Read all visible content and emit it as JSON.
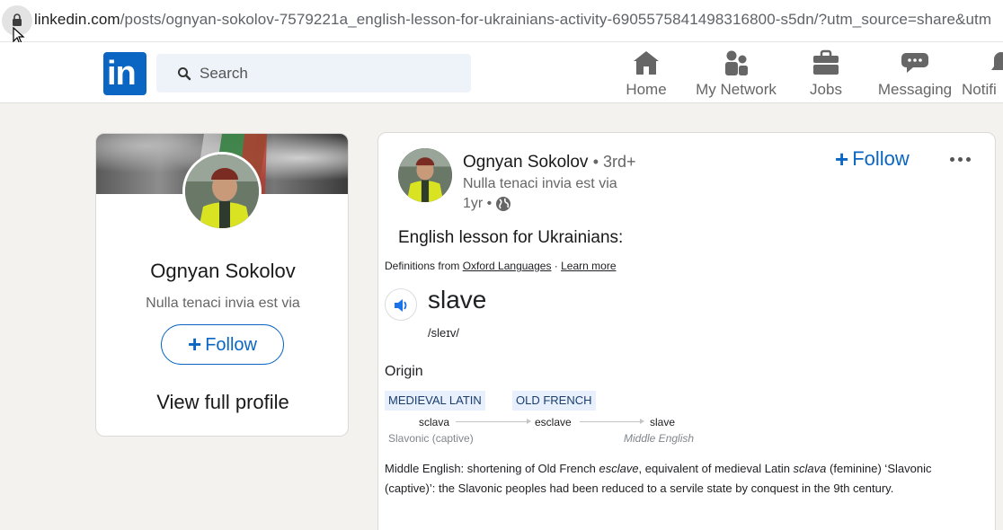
{
  "browser": {
    "url_domain": "linkedin.com",
    "url_path": "/posts/ognyan-sokolov-7579221a_english-lesson-for-ukrainians-activity-6905575841498316800-s5dn/?utm_source=share&utm"
  },
  "nav": {
    "logo_text": "in",
    "search_placeholder": "Search",
    "items": [
      {
        "label": "Home",
        "icon": "home-icon"
      },
      {
        "label": "My Network",
        "icon": "network-icon"
      },
      {
        "label": "Jobs",
        "icon": "briefcase-icon"
      },
      {
        "label": "Messaging",
        "icon": "messaging-icon"
      },
      {
        "label": "Notifi",
        "icon": "bell-icon"
      }
    ]
  },
  "profile_card": {
    "name": "Ognyan Sokolov",
    "headline": "Nulla tenaci invia est via",
    "follow_label": "Follow",
    "view_profile_label": "View full profile"
  },
  "post": {
    "author": "Ognyan Sokolov",
    "degree": "• 3rd+",
    "headline": "Nulla tenaci invia est via",
    "time": "1yr •",
    "follow_label": "Follow",
    "text": "English lesson for Ukrainians:"
  },
  "dictionary": {
    "defs_prefix": "Definitions from ",
    "source": "Oxford Languages",
    "separator": " · ",
    "learn_more": "Learn more",
    "word": "slave",
    "phonetic": "/sleɪv/",
    "origin_label": "Origin",
    "tags": [
      "MEDIEVAL LATIN",
      "OLD FRENCH"
    ],
    "etymology": [
      {
        "word": "sclava",
        "gloss": "Slavonic (captive)"
      },
      {
        "word": "esclave",
        "gloss": ""
      },
      {
        "word": "slave",
        "gloss": "Middle English"
      }
    ],
    "def_1": "Middle English: shortening of Old French ",
    "def_2": "esclave",
    "def_3": ", equivalent of medieval Latin ",
    "def_4": "sclava",
    "def_5": " (feminine) ‘Slavonic (captive)’: the Slavonic peoples had been reduced to a servile state by conquest in the 9th century."
  },
  "colors": {
    "brand": "#0a66c2",
    "page_bg": "#f4f2ee",
    "tag_bg": "#e8f0fe"
  }
}
